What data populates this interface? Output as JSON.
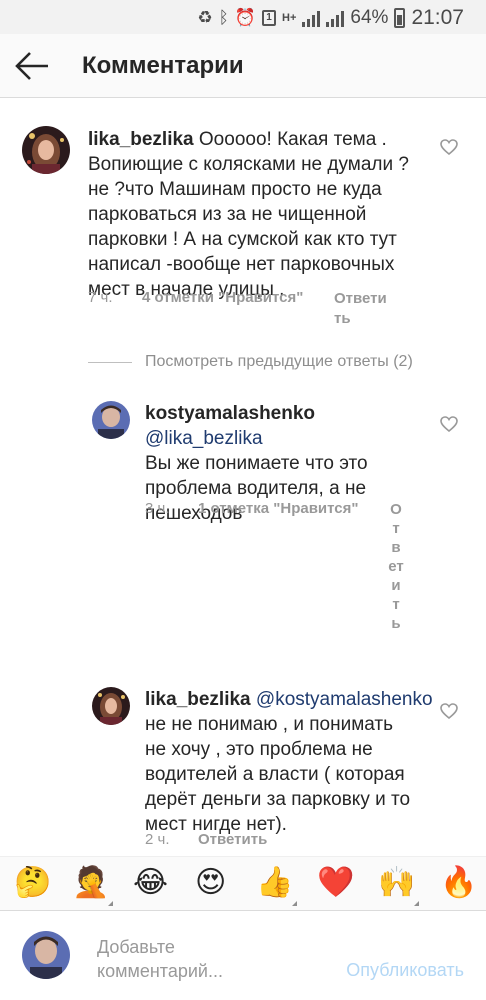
{
  "status_bar": {
    "battery": "64%",
    "time": "21:07",
    "sim_label": "1",
    "network": "H+"
  },
  "header": {
    "title": "Комментарии",
    "back_icon": "arrow-left-icon"
  },
  "comments": [
    {
      "username": "lika_bezlika",
      "mention": "",
      "text_lines": [
        "Оооооо! Какая тема .",
        "Вопиющие с колясками не думали ?",
        "не ?что Машинам просто не куда",
        "парковаться из за не чищенной",
        "парковки ! А на сумской как кто тут",
        "написал -вообще нет парковочных",
        "мест в начале улицы ."
      ],
      "first_line_text": "Оооооо! Какая тема .",
      "time": "7 ч.",
      "likes": "4 отметки \"Нравится\"",
      "reply": "Ответить",
      "reply_shown": "Ответи\nть"
    },
    {
      "username": "kostyamalashenko",
      "mention": "@lika_bezlika",
      "text_lines": [
        "Вы же понимаете что это",
        "проблема водителя, а не",
        "пешеходов"
      ],
      "time": "3 ч.",
      "likes": "1 отметка \"Нравится\"",
      "reply": "Ответить"
    },
    {
      "username": "lika_bezlika",
      "mention": "@kostyamalashenko",
      "text_lines": [
        "не не понимаю , и понимать",
        "не хочу , это проблема не",
        "водителей а власти ( которая",
        "дерёт деньги за парковку и то",
        "мест нигде нет)."
      ],
      "time": "2 ч.",
      "likes": "",
      "reply": "Ответить"
    }
  ],
  "view_previous_replies": "Посмотреть предыдущие ответы (2)",
  "emoji_bar": [
    "🤔",
    "🤦",
    "😂",
    "😍",
    "👍",
    "❤️",
    "🙌",
    "🔥"
  ],
  "composer": {
    "placeholder": "Добавьте комментарий...",
    "publish": "Опубликовать"
  },
  "colors": {
    "text": "#262626",
    "muted": "#999999",
    "mention": "#1f3b6f",
    "publish_disabled": "#b3d7f5"
  }
}
